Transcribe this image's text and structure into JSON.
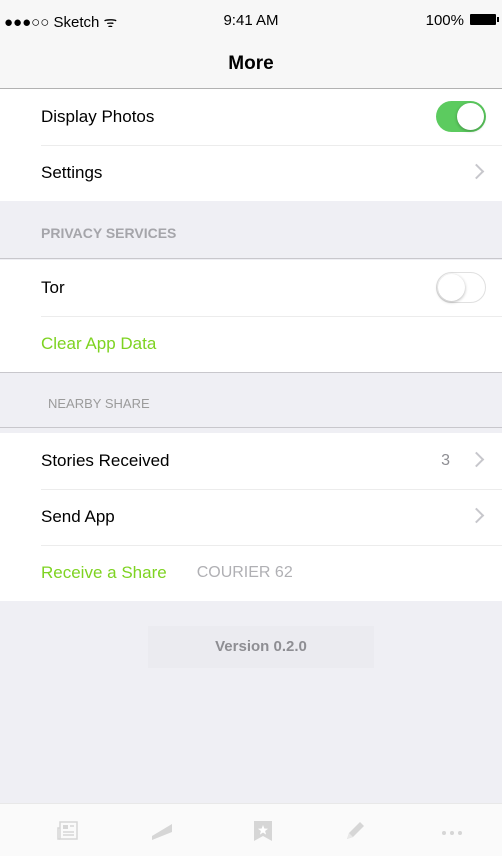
{
  "status_bar": {
    "carrier": "●●●○○ Sketch ᯤ",
    "time": "9:41 AM",
    "battery": "100%"
  },
  "nav": {
    "title": "More"
  },
  "group1": {
    "display_photos": "Display Photos",
    "settings": "Settings"
  },
  "privacy": {
    "header": "PRIVACY SERVICES",
    "tor": "Tor",
    "clear": "Clear App Data"
  },
  "nearby": {
    "header": "NEARBY SHARE",
    "stories": "Stories Received",
    "stories_count": "3",
    "send_app": "Send App",
    "receive": "Receive a Share",
    "code": "COURIER 62"
  },
  "version": "Version 0.2.0",
  "toggles": {
    "display_photos_on": true,
    "tor_on": false
  },
  "colors": {
    "accent_green": "#7ed321",
    "toggle_green": "#5ccb5f"
  },
  "tab_icons": [
    "news-icon",
    "map-icon",
    "bookmark-icon",
    "pencil-icon",
    "more-icon"
  ]
}
